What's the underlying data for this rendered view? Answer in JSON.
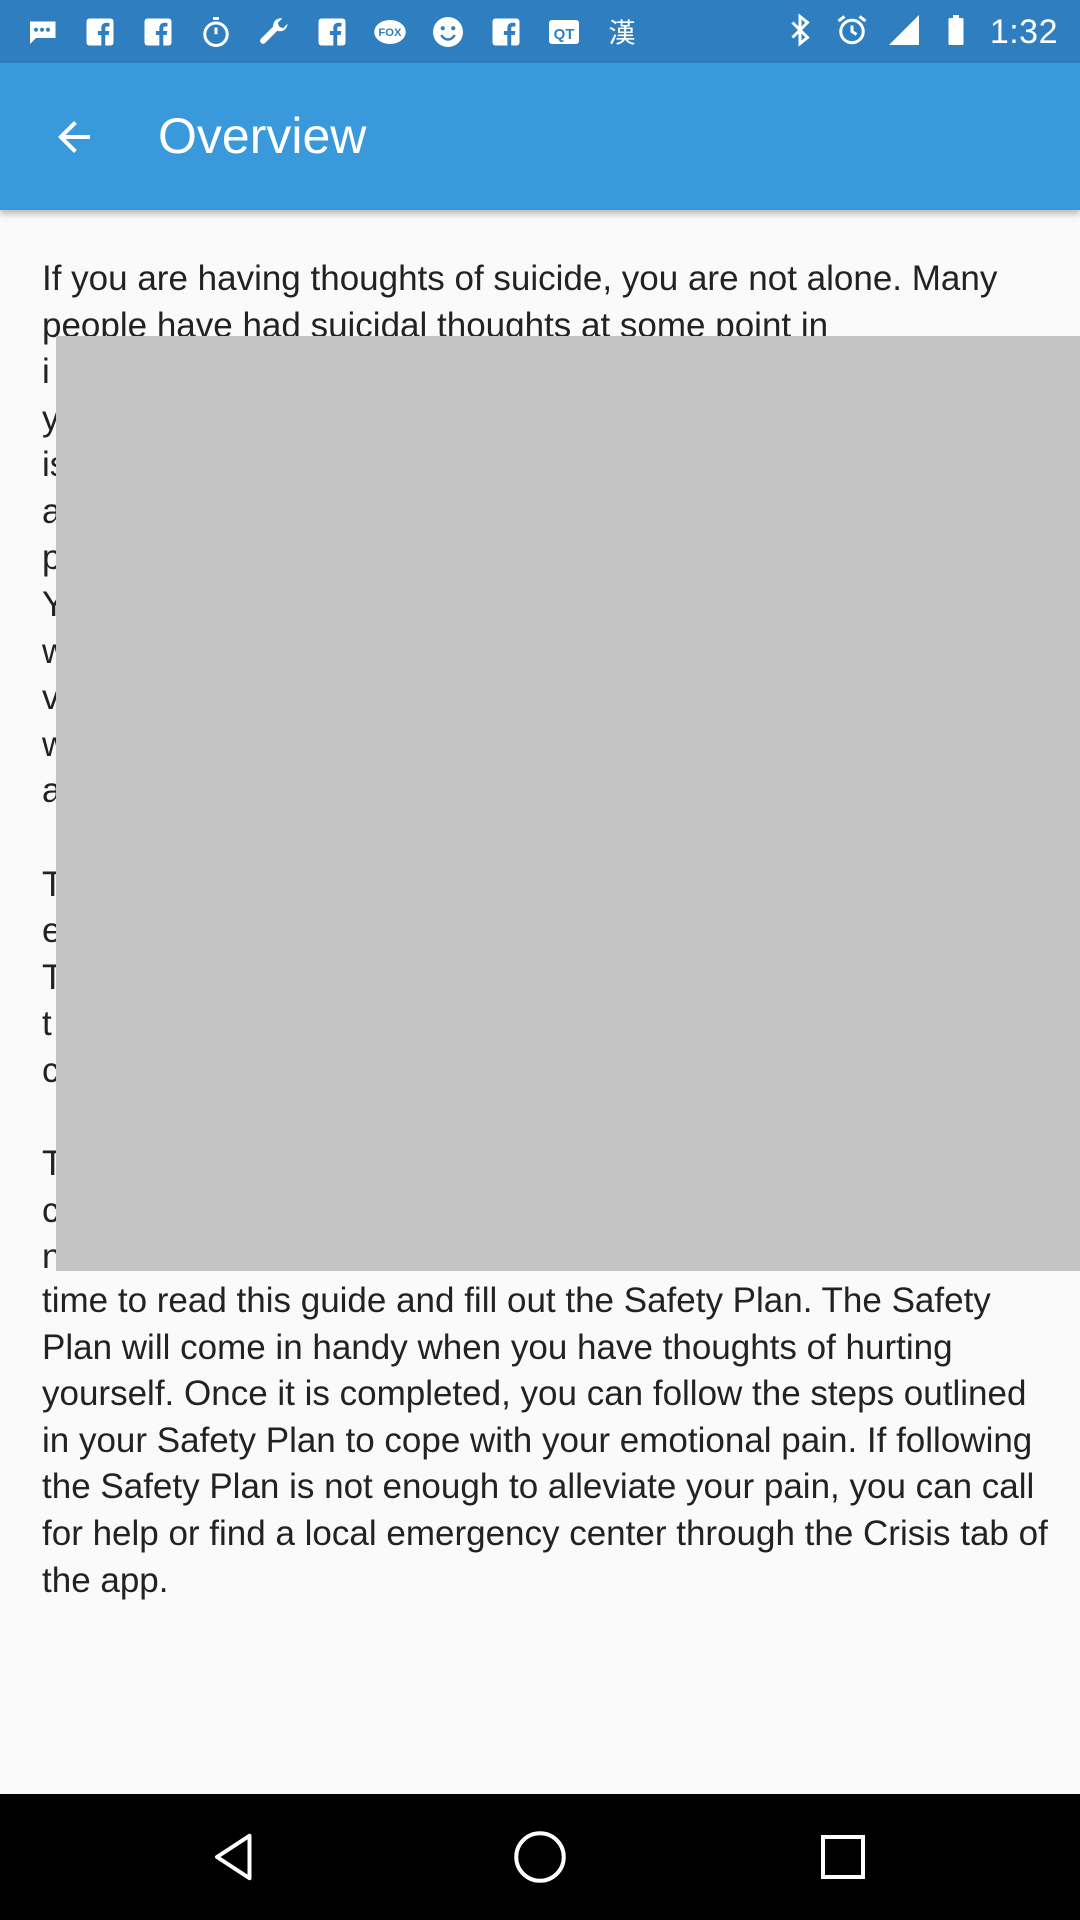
{
  "status_bar": {
    "time": "1:32",
    "notification_icons": [
      "chat-icon",
      "facebook-icon",
      "facebook-icon",
      "stopwatch-icon",
      "wrench-icon",
      "facebook-icon",
      "fox-sports-icon",
      "smiley-icon",
      "facebook-icon",
      "qt-icon",
      "kanji-icon",
      "bluetooth-icon",
      "alarm-icon",
      "signal-icon",
      "battery-icon"
    ],
    "fox_label": "FOX",
    "qt_label": "QT",
    "kanji_label": "漢"
  },
  "app_bar": {
    "title": "Overview",
    "back_icon": "arrow-left-icon"
  },
  "content": {
    "paragraphs": [
      "If you are having thoughts of suicide, you are not alone. Many people have had suicidal thoughts at some point in",
      "time to read this guide and fill out the Safety Plan. The Safety Plan will come in handy when you have thoughts of hurting yourself. Once it is completed, you can follow the steps outlined in your Safety Plan to cope with your emotional pain. If following the Safety Plan is not enough to alleviate your pain, you can call for help or find a local emergency center through the Crisis tab of the app."
    ],
    "occluded_line_starts": [
      "i",
      "y",
      "is",
      "a",
      "p",
      "Y",
      "w",
      "v",
      "w",
      "a",
      "T",
      "e",
      "T",
      "t",
      "c",
      "T",
      "c",
      "n"
    ]
  },
  "colors": {
    "status_bar": "#2f7fc0",
    "app_bar": "#3a99da",
    "background": "#fafafa",
    "overlay": "#c4c4c4",
    "nav_bar": "#000000"
  },
  "nav_bar": {
    "buttons": [
      "back-triangle-icon",
      "home-circle-icon",
      "recents-square-icon"
    ]
  }
}
